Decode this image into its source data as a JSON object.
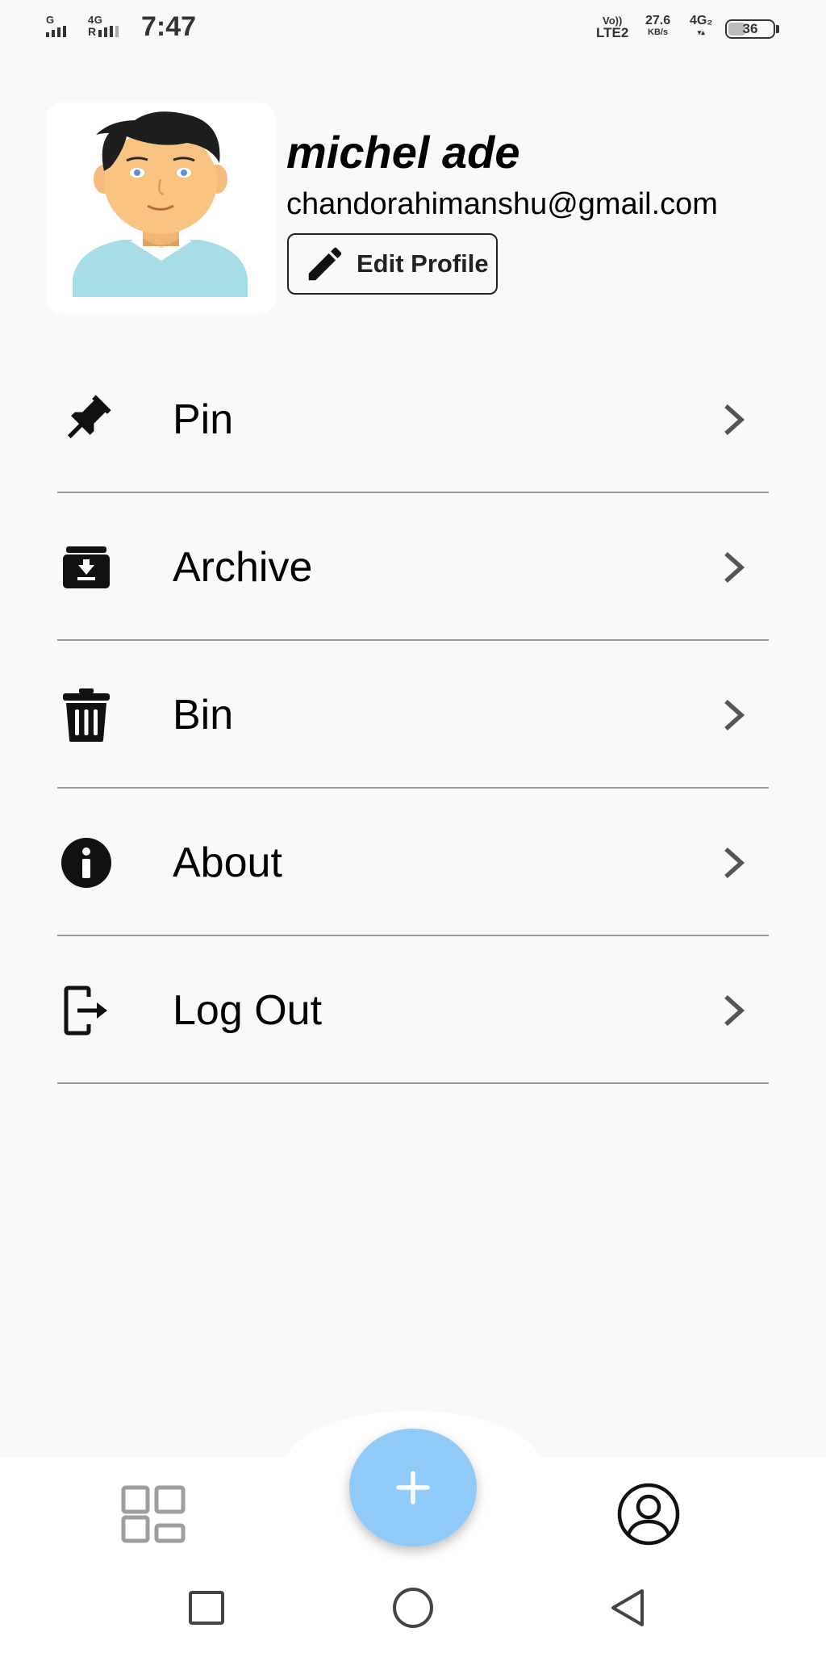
{
  "status_bar": {
    "sim1_label": "G",
    "sim2_label": "4G",
    "sim2_sub": "R",
    "time": "7:47",
    "volte_top": "Vo))",
    "volte_bottom": "LTE2",
    "net_speed": "27.6",
    "net_unit": "KB/s",
    "network_type": "4G₂",
    "battery_level": "36"
  },
  "profile": {
    "name": "michel ade",
    "email": "chandorahimanshu@gmail.com",
    "edit_label": "Edit Profile",
    "avatar_icon": "avatar-illustration"
  },
  "menu": {
    "items": [
      {
        "label": "Pin",
        "icon": "pin-icon"
      },
      {
        "label": "Archive",
        "icon": "archive-icon"
      },
      {
        "label": "Bin",
        "icon": "trash-icon"
      },
      {
        "label": "About",
        "icon": "info-icon"
      },
      {
        "label": "Log Out",
        "icon": "logout-icon"
      }
    ]
  },
  "bottom_nav": {
    "left_icon": "dashboard-icon",
    "fab_icon": "plus-icon",
    "right_icon": "account-circle-icon"
  },
  "colors": {
    "background": "#f9f9f9",
    "fab": "#90caf9",
    "divider": "#9a9a9a",
    "nav_icon": "#9e9e9e"
  }
}
